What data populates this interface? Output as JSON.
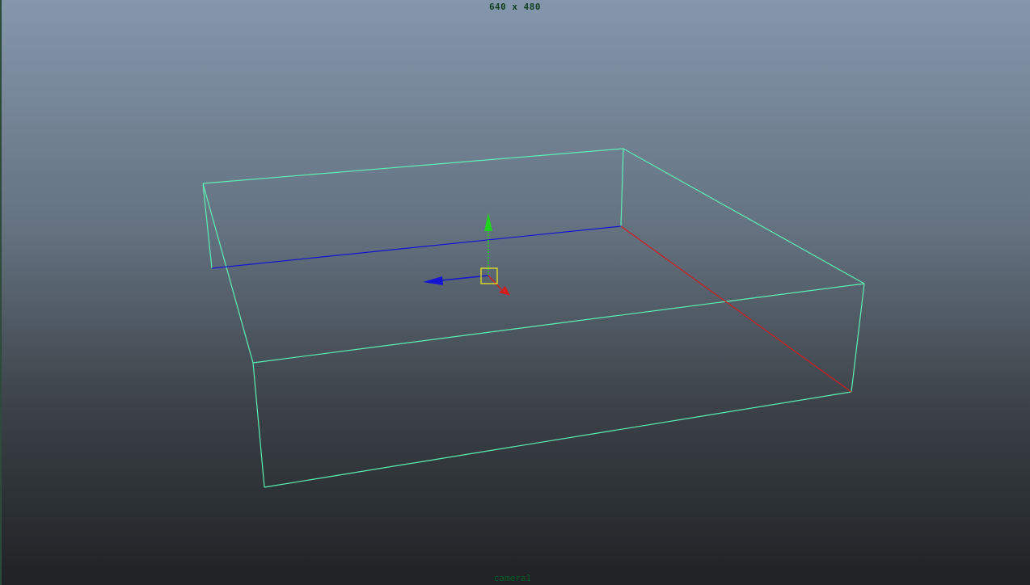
{
  "viewport": {
    "resolution_label": "640 x 480",
    "camera_label": "camera1"
  },
  "colors": {
    "wireframe": "#5cf0b4",
    "x_axis": "#d21e1e",
    "y_axis": "#1ed21e",
    "z_axis": "#1414d2",
    "manipulator_center": "#e6e61e"
  },
  "icons": {
    "move_manipulator": "translate-gizmo-icon"
  }
}
